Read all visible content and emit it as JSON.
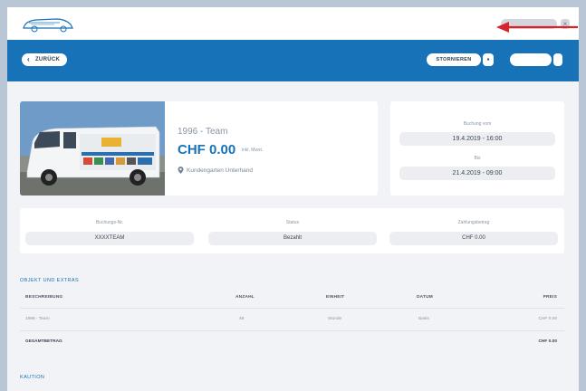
{
  "header": {
    "logo_icon": "car-logo-icon",
    "language_label": "",
    "close_icon": "close-icon"
  },
  "toolbar": {
    "back_label": "ZURÜCK",
    "action_label": "STORNIEREN",
    "action_icon": "trash-icon",
    "secondary_label": ""
  },
  "vehicle": {
    "image_icon": "van-photo",
    "name": "1996 - Team",
    "price": "CHF 0.00",
    "price_note": "inkl. Mwst.",
    "location": "Kundengarten Unterhand"
  },
  "dates": {
    "from_label": "Buchung vom",
    "from_value": "19.4.2019 - 16:00",
    "to_label": "Bis",
    "to_value": "21.4.2019 - 09:00"
  },
  "info": {
    "booking_label": "Buchungs-Nr.",
    "booking_value": "XXXXTEAM",
    "status_label": "Status",
    "status_value": "Bezahlt",
    "amount_label": "Zahlungsbetrag",
    "amount_value": "CHF 0.00"
  },
  "extras": {
    "title": "OBJEKT UND EXTRAS",
    "columns": [
      "BESCHREIBUNG",
      "ANZAHL",
      "EINHEIT",
      "DATUM",
      "PREIS"
    ],
    "row": [
      "1996 - Team",
      "48",
      "Stunde",
      "Basis",
      "CHF 0.00"
    ],
    "total_label": "GESAMTBETRAG",
    "total_value": "CHF 0.00"
  },
  "footer_section": {
    "title": "KAUTION"
  },
  "colors": {
    "brand_blue": "#1872b7",
    "annotation_red": "#d8232a",
    "outer_background": "#b9c6d6"
  }
}
